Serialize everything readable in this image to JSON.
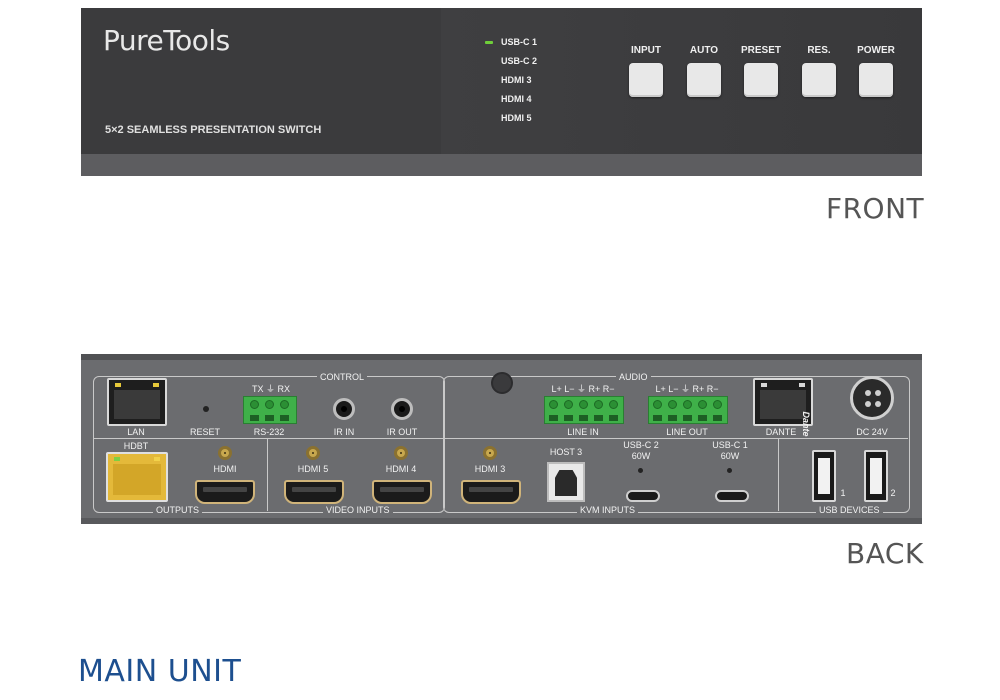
{
  "front": {
    "brand": "PureTools",
    "model": "5×2 SEAMLESS PRESENTATION SWITCH",
    "leds": [
      "USB-C 1",
      "USB-C 2",
      "HDMI 3",
      "HDMI 4",
      "HDMI 5"
    ],
    "buttons": [
      "INPUT",
      "AUTO",
      "PRESET",
      "RES.",
      "POWER"
    ],
    "caption": "FRONT"
  },
  "back": {
    "sections": {
      "control": "CONTROL",
      "audio": "AUDIO",
      "outputs": "OUTPUTS",
      "video_inputs": "VIDEO INPUTS",
      "kvm_inputs": "KVM INPUTS",
      "usb_devices": "USB DEVICES"
    },
    "ports": {
      "lan": "LAN",
      "reset": "RESET",
      "rs232": "RS-232",
      "rs232_pins": "TX ⏚ RX",
      "ir_in": "IR IN",
      "ir_out": "IR OUT",
      "line_in": "LINE IN",
      "line_out": "LINE OUT",
      "line_pins": "L+ L− ⏚ R+ R−",
      "dante": "DANTE",
      "dante_logo": "Dante",
      "dc": "DC 24V",
      "hdbt": "HDBT",
      "hdmi_out": "HDMI",
      "hdmi5": "HDMI 5",
      "hdmi4": "HDMI 4",
      "hdmi3": "HDMI 3",
      "host3": "HOST 3",
      "usbc2": "USB-C 2",
      "usbc2_power": "60W",
      "usbc1": "USB-C 1",
      "usbc1_power": "60W",
      "usb1": "1",
      "usb2": "2"
    },
    "caption": "BACK"
  },
  "page_title": "MAIN UNIT",
  "colors": {
    "led_green": "#6fcf3a",
    "terminal_green": "#3fb049",
    "title_blue": "#1d4f8f",
    "hdbt_yellow": "#e7c93a"
  }
}
